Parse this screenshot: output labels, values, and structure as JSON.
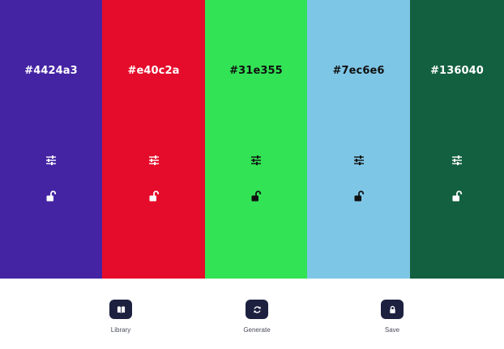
{
  "swatches": [
    {
      "hex_label": "#4424a3",
      "color": "#4424a3",
      "text_color": "#ffffff",
      "icon_color": "#ffffff",
      "locked": false
    },
    {
      "hex_label": "#e40c2a",
      "color": "#e40c2a",
      "text_color": "#ffffff",
      "icon_color": "#ffffff",
      "locked": false
    },
    {
      "hex_label": "#31e355",
      "color": "#31e355",
      "text_color": "#111111",
      "icon_color": "#111111",
      "locked": false
    },
    {
      "hex_label": "#7ec6e6",
      "color": "#7ec6e6",
      "text_color": "#111111",
      "icon_color": "#111111",
      "locked": false
    },
    {
      "hex_label": "#136040",
      "color": "#136040",
      "text_color": "#ffffff",
      "icon_color": "#ffffff",
      "locked": false
    }
  ],
  "toolbar": {
    "library": {
      "label": "Library",
      "icon": "book-icon"
    },
    "generate": {
      "label": "Generate",
      "icon": "refresh-icon"
    },
    "save": {
      "label": "Save",
      "icon": "lock-icon"
    },
    "button_color": "#1e2040"
  }
}
